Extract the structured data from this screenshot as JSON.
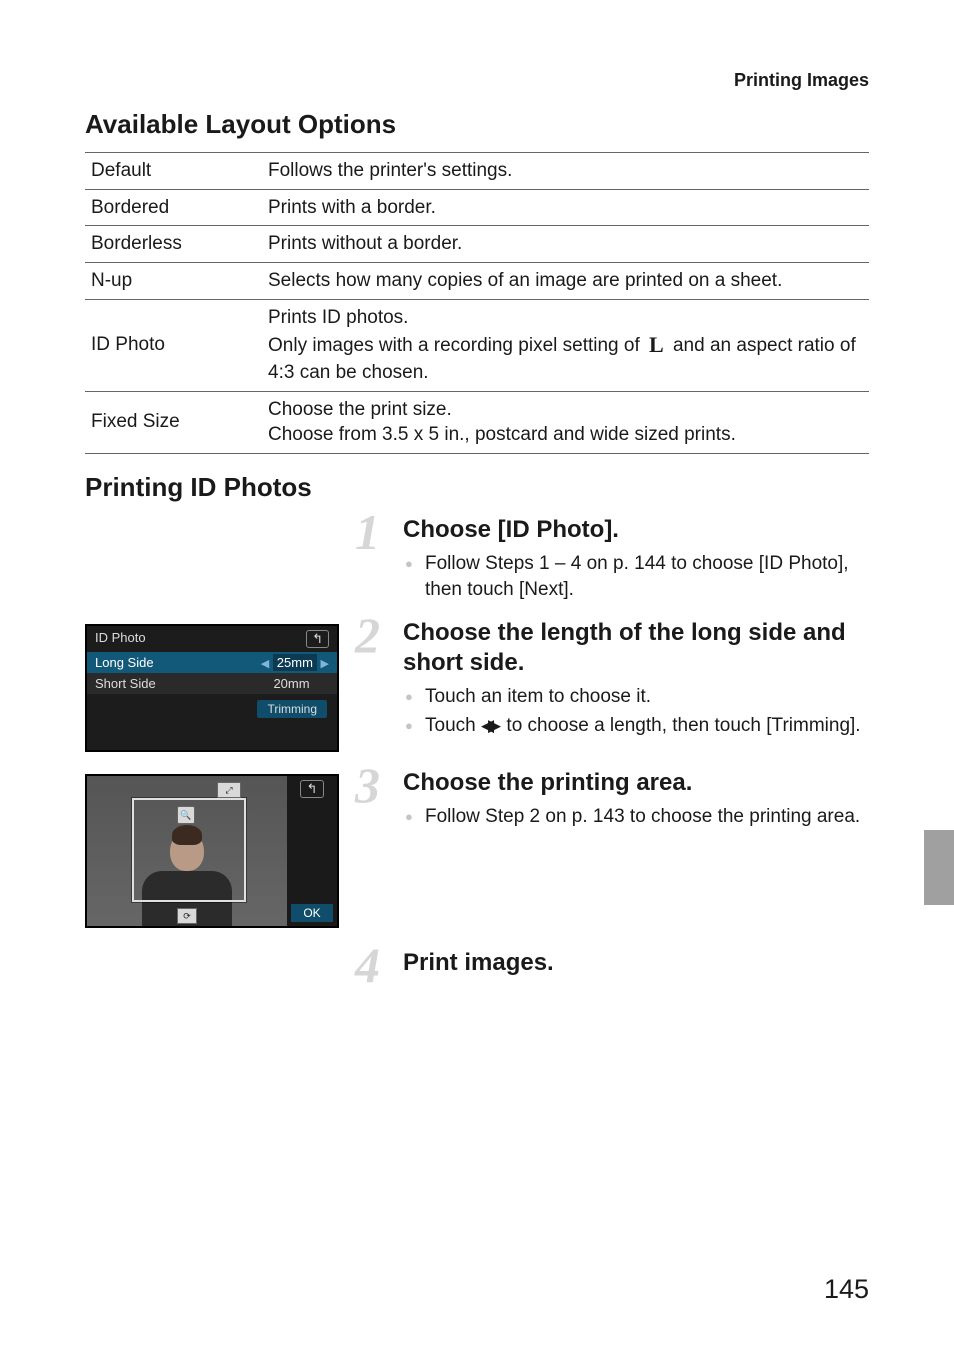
{
  "header": {
    "section_title": "Printing Images"
  },
  "h_layout": "Available Layout Options",
  "layout_table": [
    {
      "name": "Default",
      "desc": "Follows the printer's settings."
    },
    {
      "name": "Bordered",
      "desc": "Prints with a border."
    },
    {
      "name": "Borderless",
      "desc": "Prints without a border."
    },
    {
      "name": "N-up",
      "desc": "Selects how many copies of an image are printed on a sheet."
    },
    {
      "name": "ID Photo",
      "desc_pre": "Prints ID photos.\nOnly images with a recording pixel setting of ",
      "pixel_symbol": "L",
      "desc_post": " and an aspect ratio of 4:3 can be chosen."
    },
    {
      "name": "Fixed Size",
      "desc": "Choose the print size.\nChoose from 3.5 x 5 in., postcard and wide sized prints."
    }
  ],
  "h_idphotos": "Printing ID Photos",
  "steps": {
    "s1": {
      "num": "1",
      "title": "Choose [ID Photo].",
      "b1": "Follow Steps 1 – 4 on p. 144 to choose [ID Photo], then touch [Next]."
    },
    "s2": {
      "num": "2",
      "title": "Choose the length of the long side and short side.",
      "b1": "Touch an item to choose it.",
      "b2a": "Touch ",
      "b2b": " to choose a length, then touch [Trimming]."
    },
    "s3": {
      "num": "3",
      "title": "Choose the printing area.",
      "b1": "Follow Step 2 on p. 143 to choose the printing area."
    },
    "s4": {
      "num": "4",
      "title": "Print images."
    }
  },
  "lcd1": {
    "title": "ID Photo",
    "row1_label": "Long Side",
    "row1_value": "25mm",
    "row2_label": "Short Side",
    "row2_value": "20mm",
    "button": "Trimming"
  },
  "lcd2": {
    "ok": "OK"
  },
  "page_number": "145"
}
